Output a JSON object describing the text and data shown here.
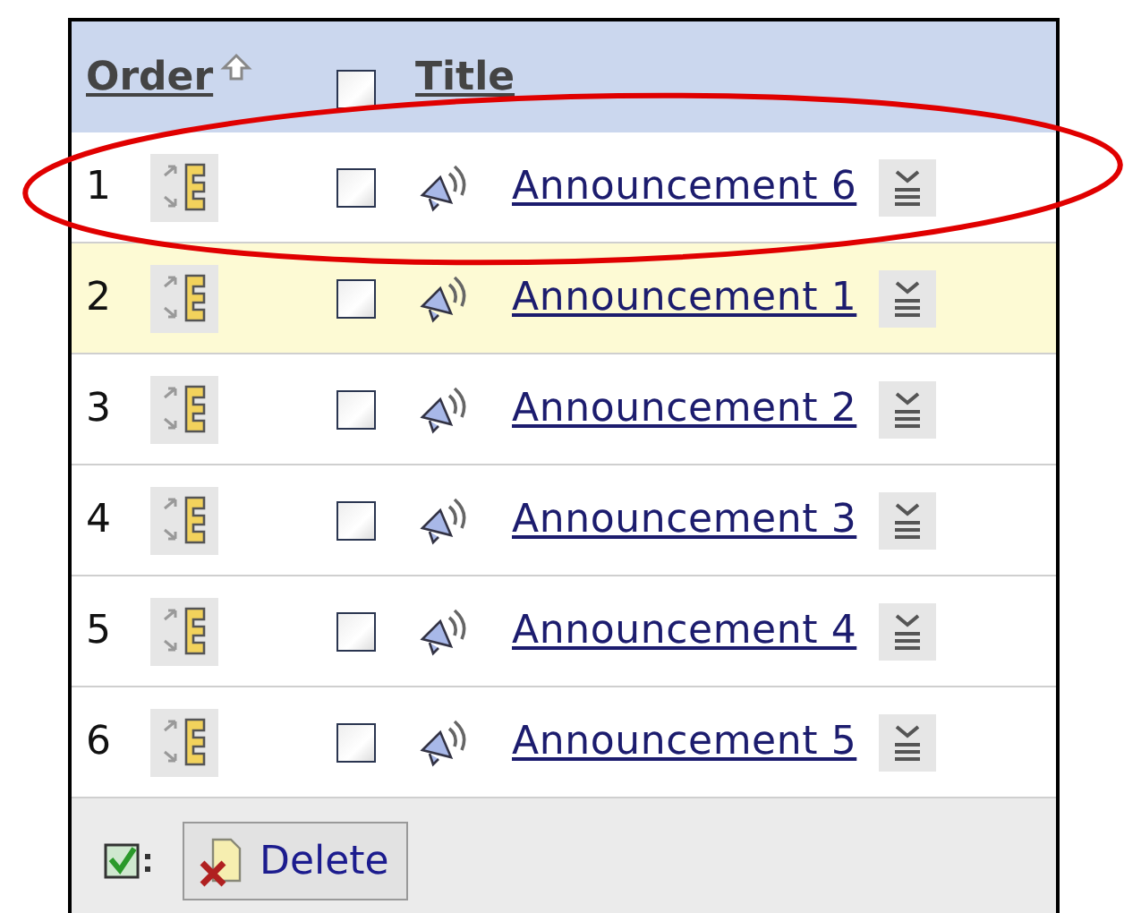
{
  "header": {
    "order_label": "Order",
    "select_all": {
      "checked": false
    },
    "title_label": "Title"
  },
  "rows": [
    {
      "number": "1",
      "checked": false,
      "title": "Announcement 6",
      "highlighted": false
    },
    {
      "number": "2",
      "checked": false,
      "title": "Announcement 1",
      "highlighted": true
    },
    {
      "number": "3",
      "checked": false,
      "title": "Announcement 2",
      "highlighted": false
    },
    {
      "number": "4",
      "checked": false,
      "title": "Announcement 3",
      "highlighted": false
    },
    {
      "number": "5",
      "checked": false,
      "title": "Announcement 4",
      "highlighted": false
    },
    {
      "number": "6",
      "checked": false,
      "title": "Announcement 5",
      "highlighted": false
    }
  ],
  "footer": {
    "delete_label": "Delete"
  }
}
